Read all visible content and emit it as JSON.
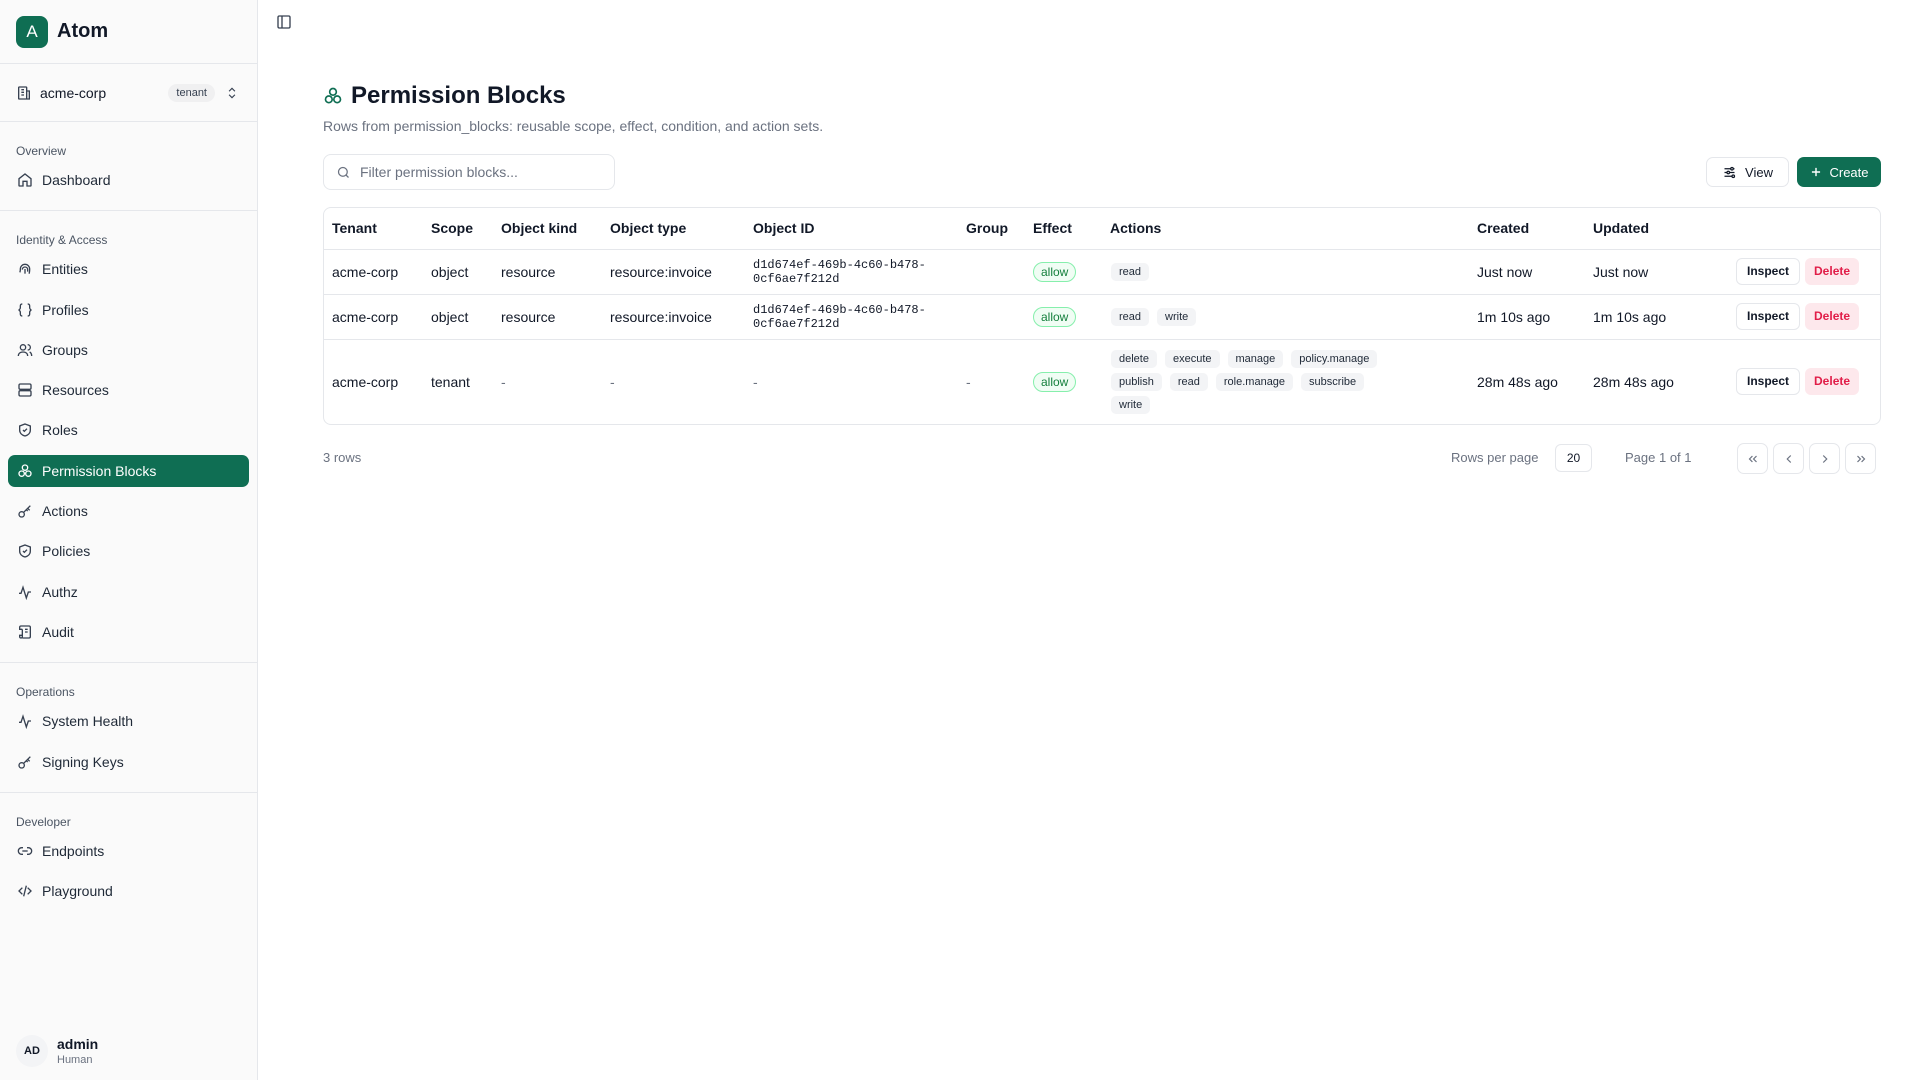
{
  "brand": {
    "logo_letter": "A",
    "name": "Atom"
  },
  "tenant": {
    "name": "acme-corp",
    "badge": "tenant"
  },
  "nav": {
    "overview_title": "Overview",
    "dashboard": "Dashboard",
    "identity_title": "Identity & Access",
    "entities": "Entities",
    "profiles": "Profiles",
    "groups": "Groups",
    "resources": "Resources",
    "roles": "Roles",
    "permission_blocks": "Permission Blocks",
    "actions": "Actions",
    "policies": "Policies",
    "authz": "Authz",
    "audit": "Audit",
    "operations_title": "Operations",
    "system_health": "System Health",
    "signing_keys": "Signing Keys",
    "developer_title": "Developer",
    "endpoints": "Endpoints",
    "playground": "Playground"
  },
  "user": {
    "initials": "AD",
    "name": "admin",
    "role": "Human"
  },
  "page": {
    "title": "Permission Blocks",
    "subtitle": "Rows from permission_blocks: reusable scope, effect, condition, and action sets.",
    "filter_placeholder": "Filter permission blocks...",
    "view_label": "View",
    "create_label": "Create"
  },
  "table": {
    "columns": [
      "Tenant",
      "Scope",
      "Object kind",
      "Object type",
      "Object ID",
      "Group",
      "Effect",
      "Actions",
      "Created",
      "Updated"
    ],
    "rows": [
      {
        "tenant": "acme-corp",
        "scope": "object",
        "object_kind": "resource",
        "object_type": "resource:invoice",
        "object_id": "d1d674ef-469b-4c60-b478-0cf6ae7f212d",
        "group": "",
        "effect": "allow",
        "actions": [
          "read"
        ],
        "created": "Just now",
        "updated": "Just now"
      },
      {
        "tenant": "acme-corp",
        "scope": "object",
        "object_kind": "resource",
        "object_type": "resource:invoice",
        "object_id": "d1d674ef-469b-4c60-b478-0cf6ae7f212d",
        "group": "",
        "effect": "allow",
        "actions": [
          "read",
          "write"
        ],
        "created": "1m 10s ago",
        "updated": "1m 10s ago"
      },
      {
        "tenant": "acme-corp",
        "scope": "tenant",
        "object_kind": "-",
        "object_type": "-",
        "object_id": "-",
        "group": "-",
        "effect": "allow",
        "actions": [
          "delete",
          "execute",
          "manage",
          "policy.manage",
          "publish",
          "read",
          "role.manage",
          "subscribe",
          "write"
        ],
        "created": "28m 48s ago",
        "updated": "28m 48s ago"
      }
    ],
    "inspect_label": "Inspect",
    "delete_label": "Delete"
  },
  "footer": {
    "row_count": "3 rows",
    "rows_per_page_label": "Rows per page",
    "rows_per_page_value": "20",
    "page_label": "Page 1 of 1"
  },
  "colors": {
    "accent": "#0f6e53",
    "danger": "#e11d48",
    "success": "#15803d"
  }
}
